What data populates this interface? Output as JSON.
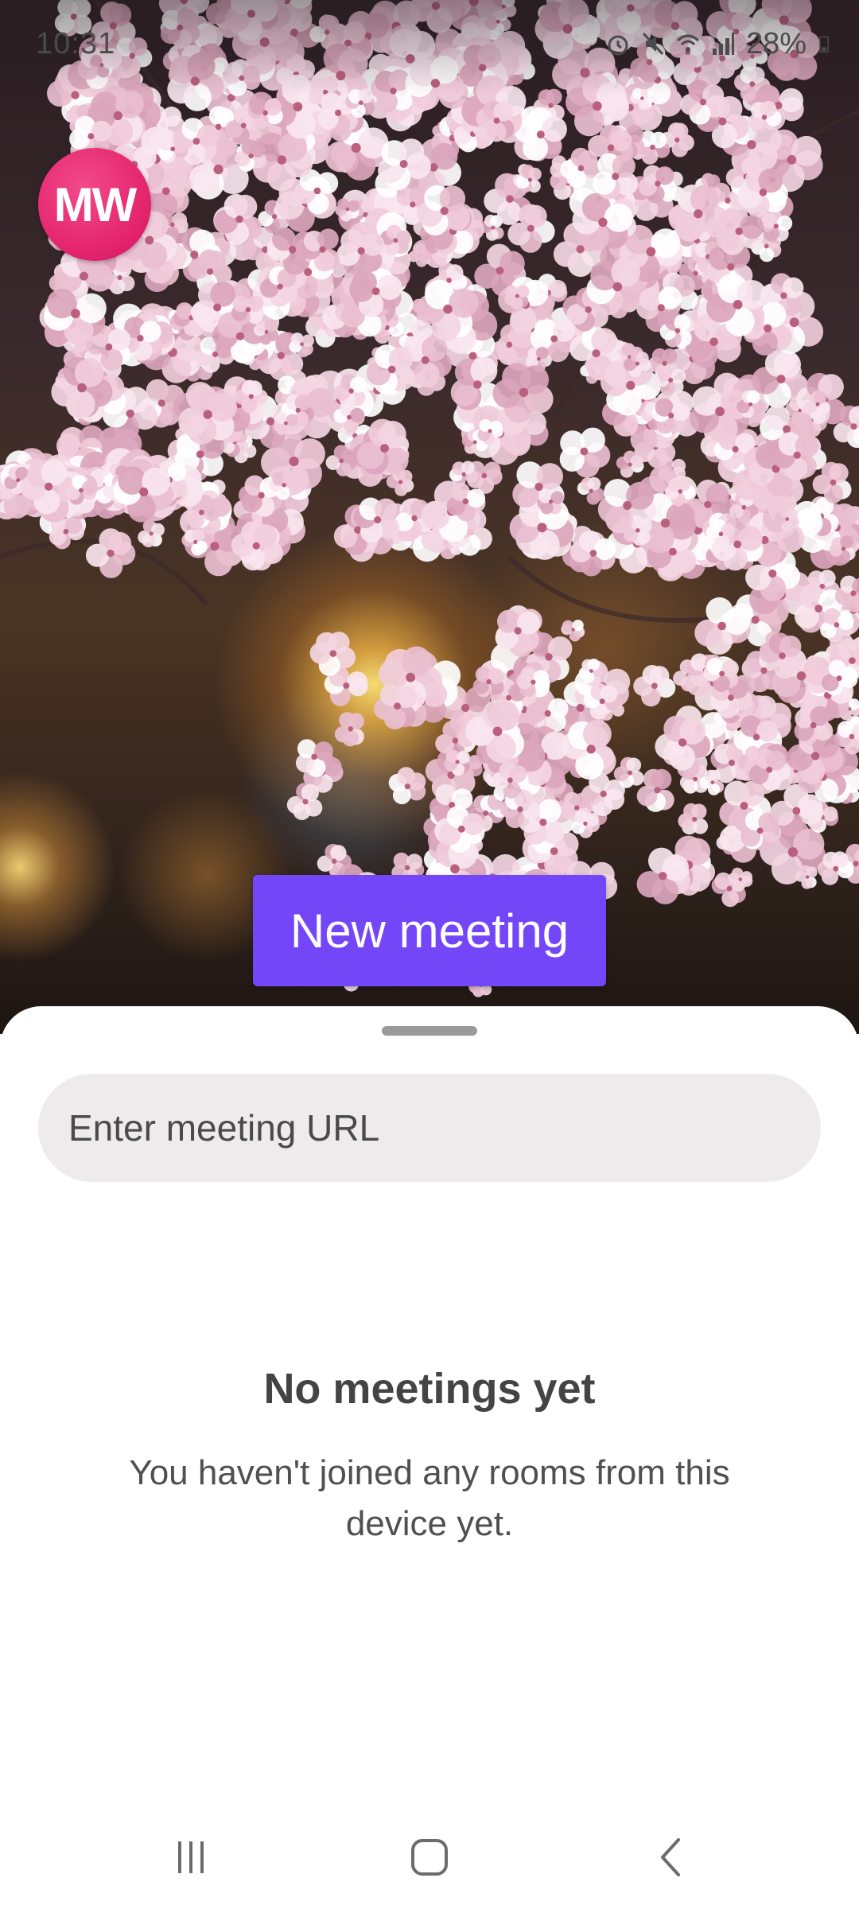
{
  "status_bar": {
    "time": "10:31",
    "battery_percent": "28%"
  },
  "profile": {
    "initials": "MW",
    "avatar_color": "#e5276f"
  },
  "hero": {
    "new_meeting_label": "New meeting",
    "accent_color": "#7347f7"
  },
  "sheet": {
    "url_input_placeholder": "Enter meeting URL",
    "url_input_value": "",
    "empty_title": "No meetings yet",
    "empty_description": "You haven't joined any rooms from this device yet."
  },
  "nav_bar": {
    "buttons": [
      "recents-icon",
      "home-icon",
      "back-icon"
    ]
  }
}
